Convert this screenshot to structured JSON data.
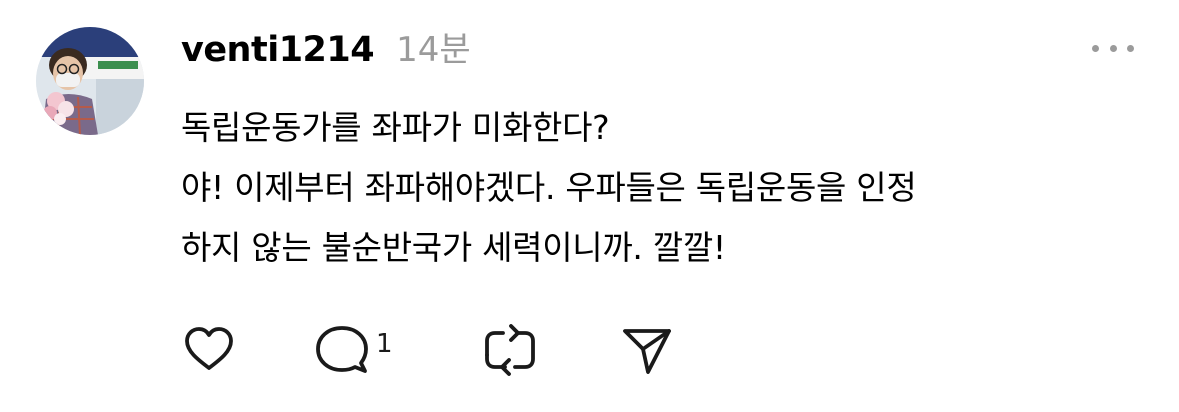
{
  "post": {
    "username": "venti1214",
    "timestamp": "14분",
    "lines": [
      "독립운동가를 좌파가 미화한다?",
      "야! 이제부터 좌파해야겠다. 우파들은 독립운동을 인정",
      "하지 않는 불순반국가 세력이니까. 깔깔!"
    ]
  },
  "actions": {
    "reply_count": "1"
  },
  "icons": {
    "avatar": "user-avatar-photo",
    "more": "more-dots-icon",
    "like": "heart-icon",
    "reply": "speech-bubble-icon",
    "repost": "repost-arrows-icon",
    "share": "paper-plane-icon"
  },
  "colors": {
    "text": "#000000",
    "secondary": "#9b9b9b",
    "icon": "#1a1a1a",
    "background": "#ffffff"
  }
}
